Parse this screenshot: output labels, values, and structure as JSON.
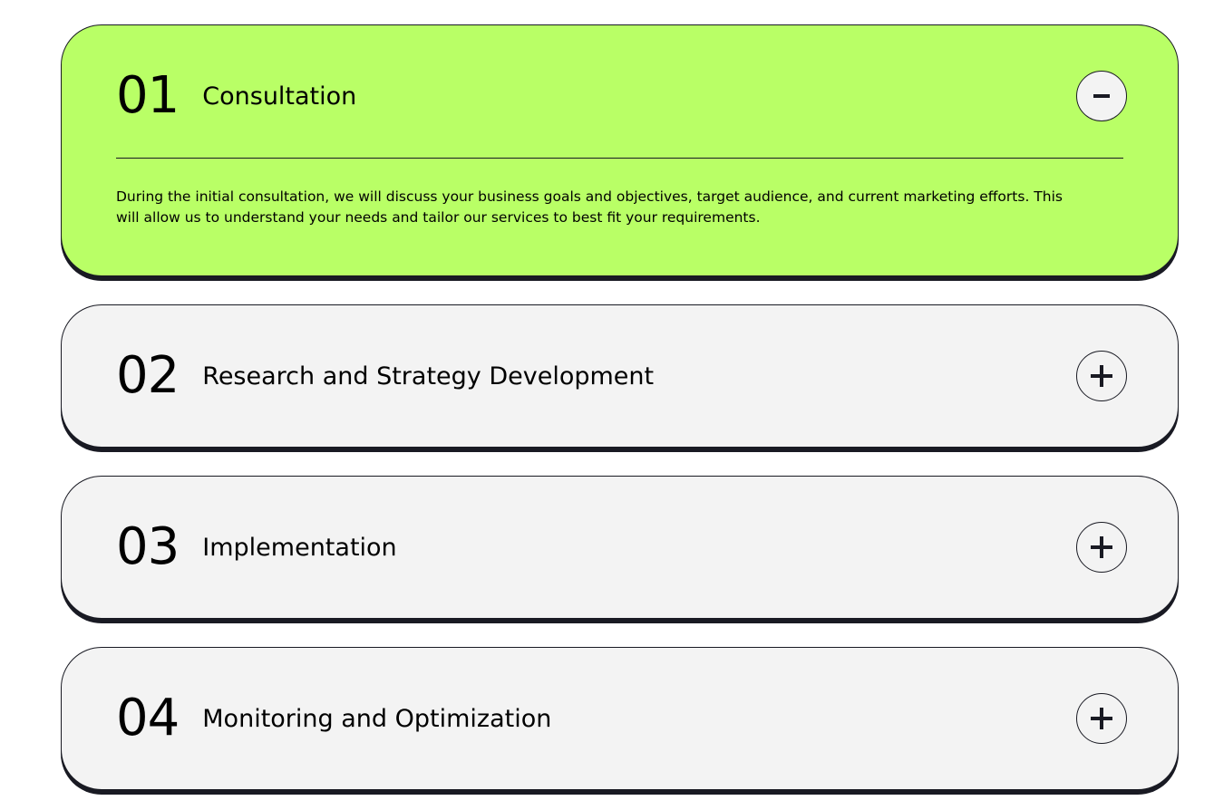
{
  "steps": [
    {
      "number": "01",
      "title": "Consultation",
      "expanded": true,
      "toggle_icon": "minus-icon",
      "description": "During the initial consultation, we will discuss your business goals and objectives, target audience, and current marketing efforts. This will allow us to understand your needs and tailor our services to best fit your requirements."
    },
    {
      "number": "02",
      "title": "Research and Strategy Development",
      "expanded": false,
      "toggle_icon": "plus-icon"
    },
    {
      "number": "03",
      "title": "Implementation",
      "expanded": false,
      "toggle_icon": "plus-icon"
    },
    {
      "number": "04",
      "title": "Monitoring and Optimization",
      "expanded": false,
      "toggle_icon": "plus-icon"
    }
  ],
  "colors": {
    "open_card": "#B9FF66",
    "closed_card": "#F3F3F3",
    "border": "#191A23"
  }
}
